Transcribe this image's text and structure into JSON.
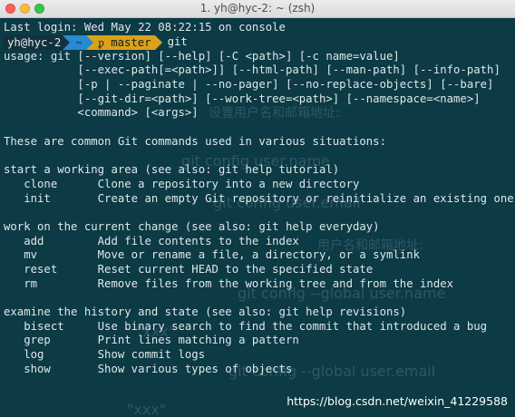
{
  "window": {
    "title": "1. yh@hyc-2: ~ (zsh)"
  },
  "prompt": {
    "user": "yh@hyc-2",
    "dir": "~",
    "branch": "ᵱ master",
    "command": "git"
  },
  "terminal_lines": [
    "Last login: Wed May 22 08:22:15 on console",
    "__PROMPT__",
    "usage: git [--version] [--help] [-C <path>] [-c name=value]",
    "           [--exec-path[=<path>]] [--html-path] [--man-path] [--info-path]",
    "           [-p | --paginate | --no-pager] [--no-replace-objects] [--bare]",
    "           [--git-dir=<path>] [--work-tree=<path>] [--namespace=<name>]",
    "           <command> [<args>]",
    "",
    "These are common Git commands used in various situations:",
    "",
    "start a working area (see also: git help tutorial)",
    "   clone      Clone a repository into a new directory",
    "   init       Create an empty Git repository or reinitialize an existing one",
    "",
    "work on the current change (see also: git help everyday)",
    "   add        Add file contents to the index",
    "   mv         Move or rename a file, a directory, or a symlink",
    "   reset      Reset current HEAD to the specified state",
    "   rm         Remove files from the working tree and from the index",
    "",
    "examine the history and state (see also: git help revisions)",
    "   bisect     Use binary search to find the commit that introduced a bug",
    "   grep       Print lines matching a pattern",
    "   log        Show commit logs",
    "   show       Show various types of objects"
  ],
  "background_text": [
    "设置用户名和邮箱地址:",
    "git config user.name",
    "git config user.email",
    "用户名和邮箱地址:",
    "git config --global user.name",
    "\"xxx\"",
    "git config --global user.email",
    "\"xxx\""
  ],
  "watermark": "https://blog.csdn.net/weixin_41229588",
  "colors": {
    "background": "#0c3a45",
    "text": "#dfe8e8",
    "segment_dir": "#268bd2",
    "segment_branch": "#d9a21b",
    "segment_user": "#12313c"
  }
}
